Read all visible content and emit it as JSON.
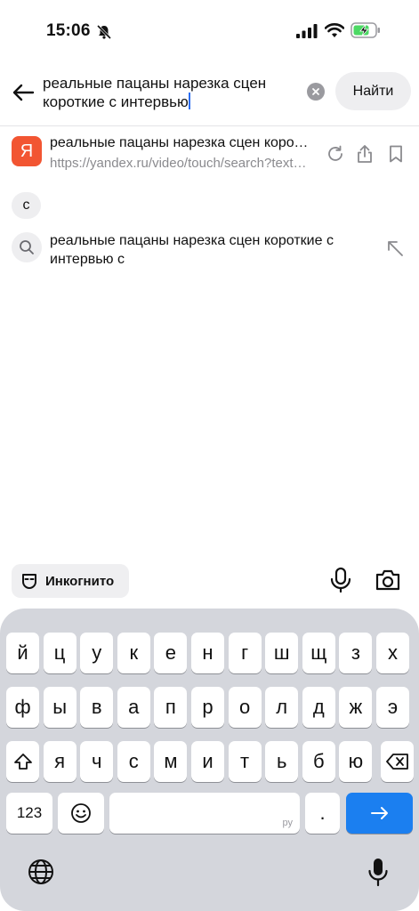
{
  "status_bar": {
    "time": "15:06",
    "icons": [
      "bell-muted-icon",
      "cellular-signal-icon",
      "wifi-icon",
      "battery-charging-icon"
    ],
    "battery_color": "#4cd964"
  },
  "search": {
    "query_line1": "реальные пацаны нарезка сцен",
    "query_line2": "короткие с интервью",
    "find_label": "Найти"
  },
  "result": {
    "logo_letter": "Я",
    "title": "реальные пацаны нарезка сцен короткие с интервью",
    "url": "https://yandex.ru/video/touch/search?text=реальные пацаны",
    "icons": [
      "refresh-icon",
      "share-icon",
      "bookmark-icon"
    ],
    "brand_color": "#f25532"
  },
  "suggestions": {
    "chip_label": "с",
    "query_line1": "реальные пацаны нарезка сцен короткие с",
    "query_line2": "интервью с"
  },
  "toolbar": {
    "incognito_label": "Инкогнито"
  },
  "keyboard": {
    "row1": [
      "й",
      "ц",
      "у",
      "к",
      "е",
      "н",
      "г",
      "ш",
      "щ",
      "з",
      "х"
    ],
    "row2": [
      "ф",
      "ы",
      "в",
      "а",
      "п",
      "р",
      "о",
      "л",
      "д",
      "ж",
      "э"
    ],
    "row3": [
      "я",
      "ч",
      "с",
      "м",
      "и",
      "т",
      "ь",
      "б",
      "ю"
    ],
    "numbers_label": "123",
    "space_lang": "ру",
    "period_label": ".",
    "accent_color": "#1b7ff0"
  }
}
